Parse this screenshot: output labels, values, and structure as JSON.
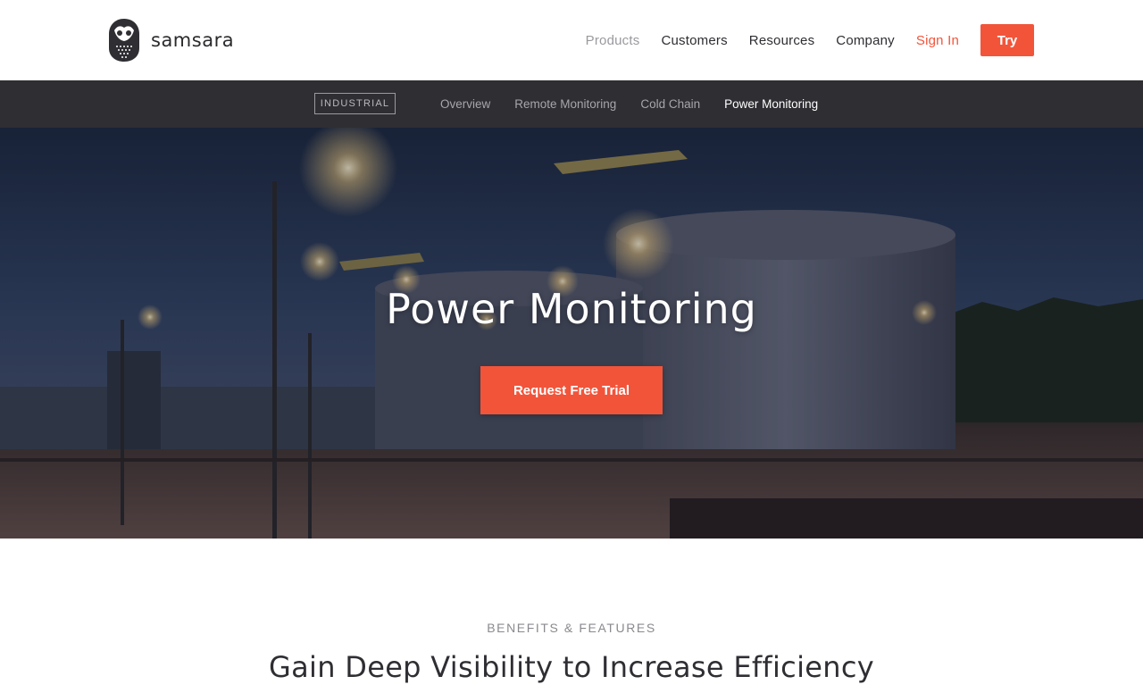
{
  "brand": {
    "name": "samsara",
    "logo_icon": "owl-icon"
  },
  "nav": {
    "items": [
      {
        "label": "Products",
        "state": "active"
      },
      {
        "label": "Customers"
      },
      {
        "label": "Resources"
      },
      {
        "label": "Company"
      }
    ],
    "sign_in": "Sign In",
    "try": "Try"
  },
  "subnav": {
    "badge": "INDUSTRIAL",
    "links": [
      "Overview",
      "Remote Monitoring",
      "Cold Chain",
      "Power Monitoring"
    ],
    "current": "Power Monitoring"
  },
  "hero": {
    "title": "Power Monitoring",
    "cta": "Request Free Trial",
    "image_alt_icon": "industrial-tanks-photo"
  },
  "benefits": {
    "eyebrow": "BENEFITS & FEATURES",
    "title": "Gain Deep Visibility to Increase Efficiency"
  },
  "colors": {
    "accent": "#f2543a",
    "subnav_bg": "#2f2e33",
    "text_dark": "#2f2e33",
    "text_muted": "#8a8a8f"
  }
}
